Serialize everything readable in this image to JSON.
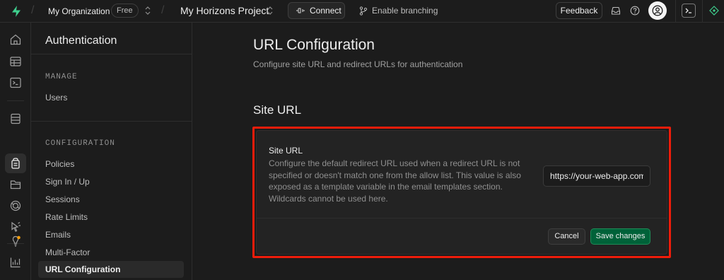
{
  "topbar": {
    "org_name": "My Organization",
    "plan_badge": "Free",
    "project_name": "My Horizons Project",
    "connect_label": "Connect",
    "branching_label": "Enable branching",
    "feedback_label": "Feedback"
  },
  "sidebar": {
    "title": "Authentication",
    "manage_heading": "MANAGE",
    "manage_items": [
      {
        "label": "Users"
      }
    ],
    "configuration_heading": "CONFIGURATION",
    "configuration_items": [
      {
        "label": "Policies"
      },
      {
        "label": "Sign In / Up"
      },
      {
        "label": "Sessions"
      },
      {
        "label": "Rate Limits"
      },
      {
        "label": "Emails"
      },
      {
        "label": "Multi-Factor"
      },
      {
        "label": "URL Configuration",
        "active": true
      }
    ]
  },
  "main": {
    "title": "URL Configuration",
    "subtitle": "Configure site URL and redirect URLs for authentication",
    "section_title": "Site URL",
    "site_url_card": {
      "label": "Site URL",
      "description": "Configure the default redirect URL used when a redirect URL is not specified or doesn't match one from the allow list. This value is also exposed as a template variable in the email templates section. Wildcards cannot be used here.",
      "input_value": "https://your-web-app.com",
      "cancel_label": "Cancel",
      "save_label": "Save changes"
    }
  },
  "colors": {
    "background": "#1c1c1c",
    "brand_green": "#3ecf8e",
    "save_button": "#006239",
    "highlight_border": "#ee1c0a",
    "notification_dot": "#f59e0b"
  },
  "icons": {
    "rail": [
      "home-icon",
      "table-editor-icon",
      "sql-editor-icon",
      "database-icon",
      "auth-icon",
      "storage-icon",
      "realtime-icon",
      "edge-functions-icon",
      "advisors-icon",
      "reports-icon"
    ]
  }
}
